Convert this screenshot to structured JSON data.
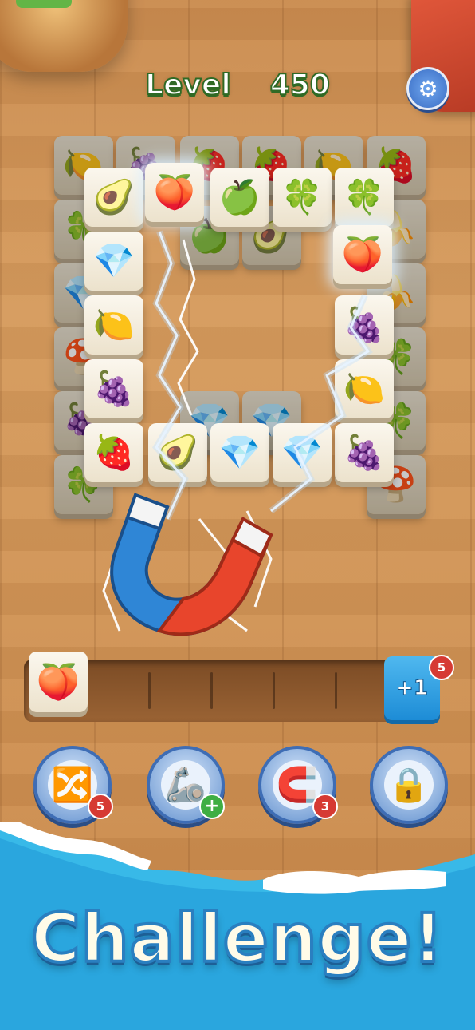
{
  "header": {
    "level_label": "Level",
    "level_number": "450",
    "settings_icon": "gear-icon"
  },
  "board": {
    "back_layer": [
      "lemon",
      "grapes",
      "strawberry",
      "raspberry",
      "lemon",
      "raspberry",
      "clover",
      "banana",
      "gem",
      "banana",
      "mushroom",
      "clover",
      "grapes",
      "clover",
      "clover",
      "mushroom"
    ],
    "front_tiles": {
      "top_row": [
        "avocado",
        "peach",
        "green-apple",
        "clover",
        "clover"
      ],
      "left_col": [
        "gem",
        "lemon",
        "grapes",
        "raspberry"
      ],
      "right_col": [
        "peach",
        "grapes",
        "lemon",
        "grapes"
      ],
      "bottom_row": [
        "avocado",
        "gem",
        "gem"
      ]
    },
    "glyphs": {
      "avocado": "🥑",
      "peach": "🍑",
      "green-apple": "🍏",
      "clover": "🍀",
      "gem": "💎",
      "lemon": "🍋",
      "grapes": "🍇",
      "raspberry": "🍓",
      "banana": "🍌",
      "mushroom": "🍄",
      "strawberry": "🍓"
    }
  },
  "magnet_active": "magnet-icon",
  "slot_bar": {
    "tiles": [
      "🍑"
    ],
    "plus_button": "+1",
    "plus_badge": "5"
  },
  "boosters": [
    {
      "name": "shuffle",
      "glyph": "🔀",
      "badge": "5"
    },
    {
      "name": "claw",
      "glyph": "🦾",
      "badge": "+"
    },
    {
      "name": "magnet",
      "glyph": "🧲",
      "badge": "3"
    },
    {
      "name": "lock",
      "glyph": "🔒",
      "badge": ""
    }
  ],
  "banner": {
    "text": "Challenge!"
  },
  "colors": {
    "accent_green": "#2f6a25",
    "banner_blue": "#2a7fc0",
    "badge_red": "#d63a33"
  }
}
